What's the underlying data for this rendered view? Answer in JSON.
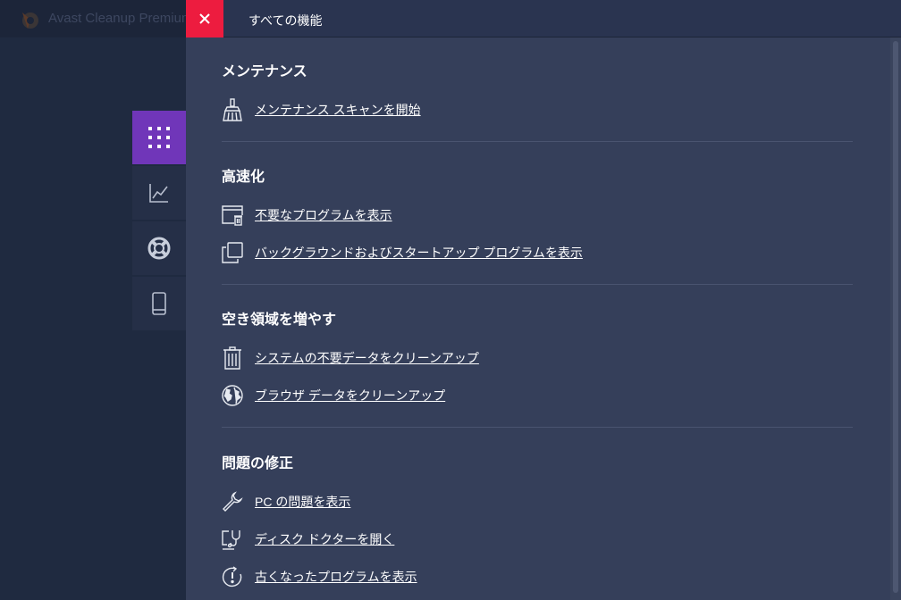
{
  "app": {
    "title": "Avast Cleanup Premium",
    "logo_icon": "avast-logo"
  },
  "side_nav": [
    {
      "name": "all-features",
      "icon": "grid-icon",
      "active": true
    },
    {
      "name": "performance",
      "icon": "chart-icon",
      "active": false
    },
    {
      "name": "support",
      "icon": "lifebuoy-icon",
      "active": false
    },
    {
      "name": "mobile",
      "icon": "phone-icon",
      "active": false
    }
  ],
  "panel": {
    "title": "すべての機能",
    "close_icon": "close-icon",
    "sections": [
      {
        "title": "メンテナンス",
        "items": [
          {
            "icon": "broom-icon",
            "label": "メンテナンス スキャンを開始"
          }
        ]
      },
      {
        "title": "高速化",
        "items": [
          {
            "icon": "window-trash-icon",
            "label": "不要なプログラムを表示"
          },
          {
            "icon": "copy-windows-icon",
            "label": "バックグラウンドおよびスタートアップ プログラムを表示"
          }
        ]
      },
      {
        "title": "空き領域を増やす",
        "items": [
          {
            "icon": "trash-icon",
            "label": "システムの不要データをクリーンアップ"
          },
          {
            "icon": "globe-icon",
            "label": "ブラウザ データをクリーンアップ"
          }
        ]
      },
      {
        "title": "問題の修正",
        "items": [
          {
            "icon": "wrench-icon",
            "label": "PC の問題を表示"
          },
          {
            "icon": "disk-doctor-icon",
            "label": "ディスク ドクターを開く"
          },
          {
            "icon": "outdated-icon",
            "label": "古くなったプログラムを表示"
          }
        ]
      }
    ]
  },
  "colors": {
    "accent_purple": "#7036b9",
    "close_red": "#ed1c3f",
    "panel_bg": "#353f5a",
    "app_bg": "#1f2a40"
  }
}
